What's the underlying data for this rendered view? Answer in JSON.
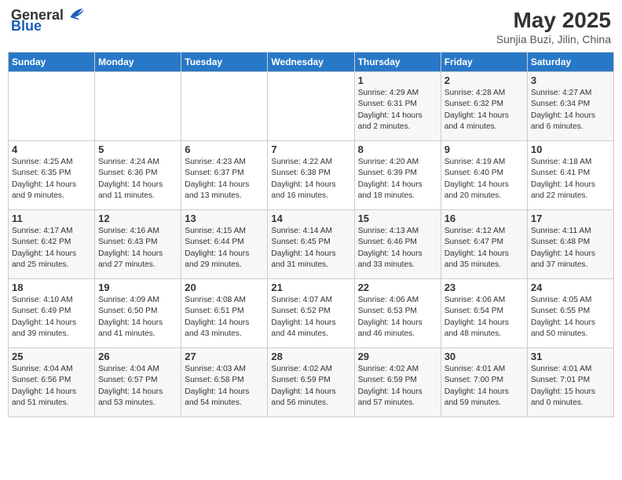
{
  "logo": {
    "general": "General",
    "blue": "Blue"
  },
  "title": "May 2025",
  "subtitle": "Sunjia Buzi, Jilin, China",
  "days_of_week": [
    "Sunday",
    "Monday",
    "Tuesday",
    "Wednesday",
    "Thursday",
    "Friday",
    "Saturday"
  ],
  "weeks": [
    [
      {
        "day": "",
        "info": ""
      },
      {
        "day": "",
        "info": ""
      },
      {
        "day": "",
        "info": ""
      },
      {
        "day": "",
        "info": ""
      },
      {
        "day": "1",
        "info": "Sunrise: 4:29 AM\nSunset: 6:31 PM\nDaylight: 14 hours\nand 2 minutes."
      },
      {
        "day": "2",
        "info": "Sunrise: 4:28 AM\nSunset: 6:32 PM\nDaylight: 14 hours\nand 4 minutes."
      },
      {
        "day": "3",
        "info": "Sunrise: 4:27 AM\nSunset: 6:34 PM\nDaylight: 14 hours\nand 6 minutes."
      }
    ],
    [
      {
        "day": "4",
        "info": "Sunrise: 4:25 AM\nSunset: 6:35 PM\nDaylight: 14 hours\nand 9 minutes."
      },
      {
        "day": "5",
        "info": "Sunrise: 4:24 AM\nSunset: 6:36 PM\nDaylight: 14 hours\nand 11 minutes."
      },
      {
        "day": "6",
        "info": "Sunrise: 4:23 AM\nSunset: 6:37 PM\nDaylight: 14 hours\nand 13 minutes."
      },
      {
        "day": "7",
        "info": "Sunrise: 4:22 AM\nSunset: 6:38 PM\nDaylight: 14 hours\nand 16 minutes."
      },
      {
        "day": "8",
        "info": "Sunrise: 4:20 AM\nSunset: 6:39 PM\nDaylight: 14 hours\nand 18 minutes."
      },
      {
        "day": "9",
        "info": "Sunrise: 4:19 AM\nSunset: 6:40 PM\nDaylight: 14 hours\nand 20 minutes."
      },
      {
        "day": "10",
        "info": "Sunrise: 4:18 AM\nSunset: 6:41 PM\nDaylight: 14 hours\nand 22 minutes."
      }
    ],
    [
      {
        "day": "11",
        "info": "Sunrise: 4:17 AM\nSunset: 6:42 PM\nDaylight: 14 hours\nand 25 minutes."
      },
      {
        "day": "12",
        "info": "Sunrise: 4:16 AM\nSunset: 6:43 PM\nDaylight: 14 hours\nand 27 minutes."
      },
      {
        "day": "13",
        "info": "Sunrise: 4:15 AM\nSunset: 6:44 PM\nDaylight: 14 hours\nand 29 minutes."
      },
      {
        "day": "14",
        "info": "Sunrise: 4:14 AM\nSunset: 6:45 PM\nDaylight: 14 hours\nand 31 minutes."
      },
      {
        "day": "15",
        "info": "Sunrise: 4:13 AM\nSunset: 6:46 PM\nDaylight: 14 hours\nand 33 minutes."
      },
      {
        "day": "16",
        "info": "Sunrise: 4:12 AM\nSunset: 6:47 PM\nDaylight: 14 hours\nand 35 minutes."
      },
      {
        "day": "17",
        "info": "Sunrise: 4:11 AM\nSunset: 6:48 PM\nDaylight: 14 hours\nand 37 minutes."
      }
    ],
    [
      {
        "day": "18",
        "info": "Sunrise: 4:10 AM\nSunset: 6:49 PM\nDaylight: 14 hours\nand 39 minutes."
      },
      {
        "day": "19",
        "info": "Sunrise: 4:09 AM\nSunset: 6:50 PM\nDaylight: 14 hours\nand 41 minutes."
      },
      {
        "day": "20",
        "info": "Sunrise: 4:08 AM\nSunset: 6:51 PM\nDaylight: 14 hours\nand 43 minutes."
      },
      {
        "day": "21",
        "info": "Sunrise: 4:07 AM\nSunset: 6:52 PM\nDaylight: 14 hours\nand 44 minutes."
      },
      {
        "day": "22",
        "info": "Sunrise: 4:06 AM\nSunset: 6:53 PM\nDaylight: 14 hours\nand 46 minutes."
      },
      {
        "day": "23",
        "info": "Sunrise: 4:06 AM\nSunset: 6:54 PM\nDaylight: 14 hours\nand 48 minutes."
      },
      {
        "day": "24",
        "info": "Sunrise: 4:05 AM\nSunset: 6:55 PM\nDaylight: 14 hours\nand 50 minutes."
      }
    ],
    [
      {
        "day": "25",
        "info": "Sunrise: 4:04 AM\nSunset: 6:56 PM\nDaylight: 14 hours\nand 51 minutes."
      },
      {
        "day": "26",
        "info": "Sunrise: 4:04 AM\nSunset: 6:57 PM\nDaylight: 14 hours\nand 53 minutes."
      },
      {
        "day": "27",
        "info": "Sunrise: 4:03 AM\nSunset: 6:58 PM\nDaylight: 14 hours\nand 54 minutes."
      },
      {
        "day": "28",
        "info": "Sunrise: 4:02 AM\nSunset: 6:59 PM\nDaylight: 14 hours\nand 56 minutes."
      },
      {
        "day": "29",
        "info": "Sunrise: 4:02 AM\nSunset: 6:59 PM\nDaylight: 14 hours\nand 57 minutes."
      },
      {
        "day": "30",
        "info": "Sunrise: 4:01 AM\nSunset: 7:00 PM\nDaylight: 14 hours\nand 59 minutes."
      },
      {
        "day": "31",
        "info": "Sunrise: 4:01 AM\nSunset: 7:01 PM\nDaylight: 15 hours\nand 0 minutes."
      }
    ]
  ]
}
